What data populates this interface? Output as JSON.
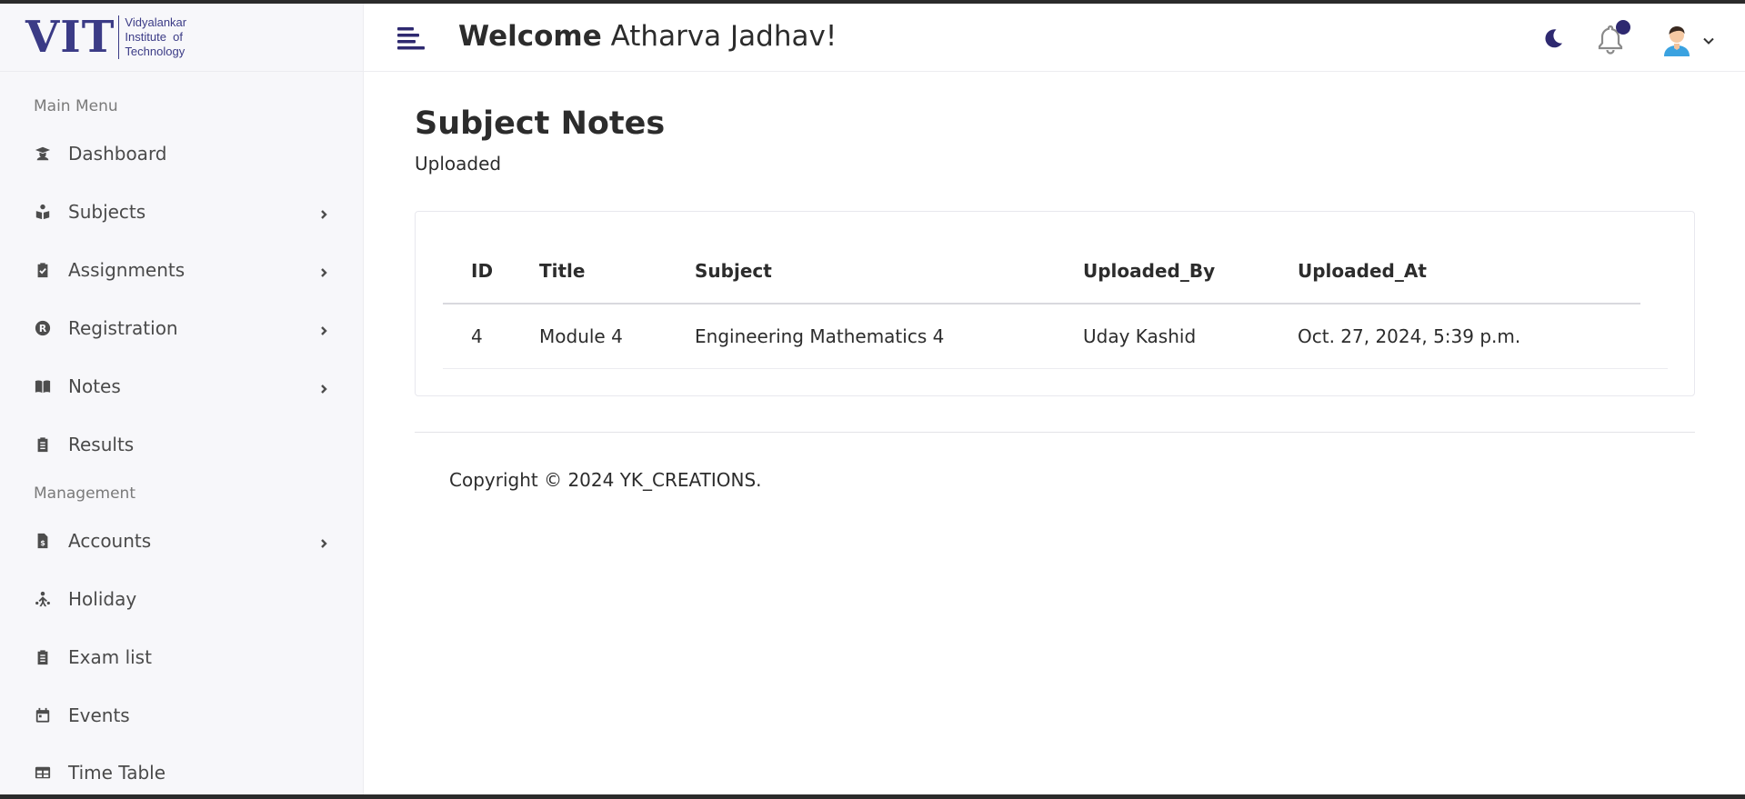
{
  "logo": {
    "mark": "VIT",
    "line1": "Vidyalankar",
    "line2": "Institute  of",
    "line3": "Technology"
  },
  "sidebar": {
    "main_menu_label": "Main Menu",
    "management_label": "Management",
    "items": [
      {
        "label": "Dashboard",
        "icon": "graduate-icon",
        "has_submenu": false
      },
      {
        "label": "Subjects",
        "icon": "book-reader-icon",
        "has_submenu": true
      },
      {
        "label": "Assignments",
        "icon": "clipboard-check-icon",
        "has_submenu": true
      },
      {
        "label": "Registration",
        "icon": "registered-icon",
        "has_submenu": true
      },
      {
        "label": "Notes",
        "icon": "book-open-icon",
        "has_submenu": true
      },
      {
        "label": "Results",
        "icon": "clipboard-list-icon",
        "has_submenu": false
      },
      {
        "label": "Accounts",
        "icon": "file-invoice-dollar-icon",
        "has_submenu": true
      },
      {
        "label": "Holiday",
        "icon": "holiday-icon",
        "has_submenu": false
      },
      {
        "label": "Exam list",
        "icon": "clipboard-list-icon",
        "has_submenu": false
      },
      {
        "label": "Events",
        "icon": "calendar-icon",
        "has_submenu": false
      },
      {
        "label": "Time Table",
        "icon": "table-icon",
        "has_submenu": false
      }
    ]
  },
  "header": {
    "welcome_bold": "Welcome",
    "user_name": "Atharva Jadhav!"
  },
  "main": {
    "title": "Subject Notes",
    "subtitle": "Uploaded",
    "table": {
      "columns": [
        "ID",
        "Title",
        "Subject",
        "Uploaded_By",
        "Uploaded_At"
      ],
      "rows": [
        [
          "4",
          "Module 4",
          "Engineering Mathematics 4",
          "Uday Kashid",
          "Oct. 27, 2024, 5:39 p.m."
        ]
      ]
    }
  },
  "footer": {
    "copyright": "Copyright © 2024 YK_CREATIONS."
  },
  "colors": {
    "brand": "#3b3b86",
    "notification_dot": "#2e2970",
    "sidebar_bg": "#f7f7fa"
  }
}
